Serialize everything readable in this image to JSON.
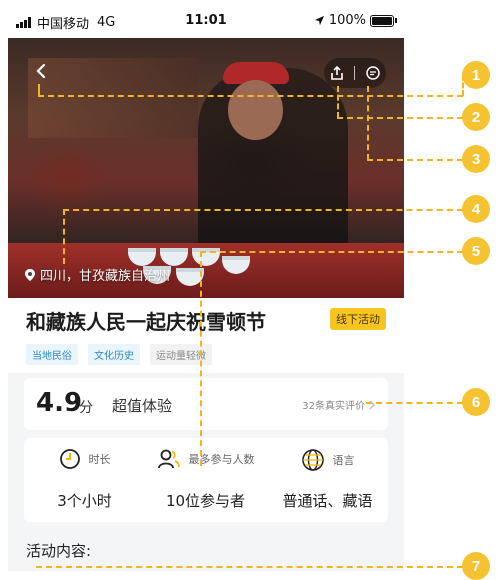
{
  "status": {
    "carrier": "中国移动",
    "network": "4G",
    "time": "11:01",
    "battery": "100%"
  },
  "hero": {
    "location": "四川，甘孜藏族自治州",
    "back_icon": "chevron-left-icon",
    "share_icon": "share-icon",
    "comment_icon": "comment-icon"
  },
  "activity": {
    "title": "和藏族人民一起庆祝雪顿节",
    "badge": "线下活动",
    "tags": [
      "当地民俗",
      "文化历史",
      "运动量轻微"
    ]
  },
  "rating": {
    "score": "4.9",
    "unit": "分",
    "label": "超值体验",
    "reviews": "32条真实评价"
  },
  "stats": [
    {
      "icon": "clock-icon",
      "label": "时长",
      "value": "3个小时"
    },
    {
      "icon": "people-icon",
      "label": "最多参与人数",
      "value": "10位参与者"
    },
    {
      "icon": "globe-icon",
      "label": "语言",
      "value": "普通话、藏语"
    }
  ],
  "section": {
    "content_title": "活动内容:"
  },
  "annotations": [
    "1",
    "2",
    "3",
    "4",
    "5",
    "6",
    "7"
  ],
  "colors": {
    "annotation": "#f5c232",
    "badge": "#f7c51f",
    "tag_blue": "#2b8ccc"
  }
}
